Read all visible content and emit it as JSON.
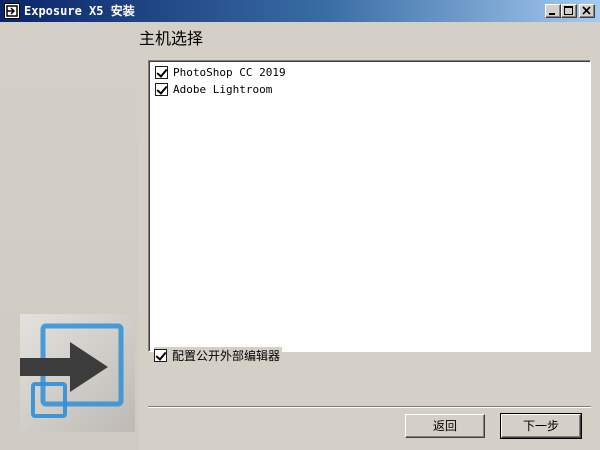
{
  "window": {
    "title": "Exposure X5 安装",
    "controls": [
      "minimize-icon",
      "maximize-icon",
      "close-icon"
    ]
  },
  "page": {
    "title": "主机选择"
  },
  "host_list": {
    "items": [
      {
        "label": "PhotoShop CC 2019",
        "checked": true
      },
      {
        "label": "Adobe Lightroom",
        "checked": true
      }
    ]
  },
  "options": {
    "config_external_editor": {
      "label": "配置公开外部编辑器",
      "checked": true
    }
  },
  "buttons": {
    "back": "返回",
    "next": "下一步"
  },
  "logo": {
    "icon": "exposure-logo-icon",
    "colors": {
      "arrow": "#3c3c3c",
      "frame": "#2f8fd6"
    }
  }
}
